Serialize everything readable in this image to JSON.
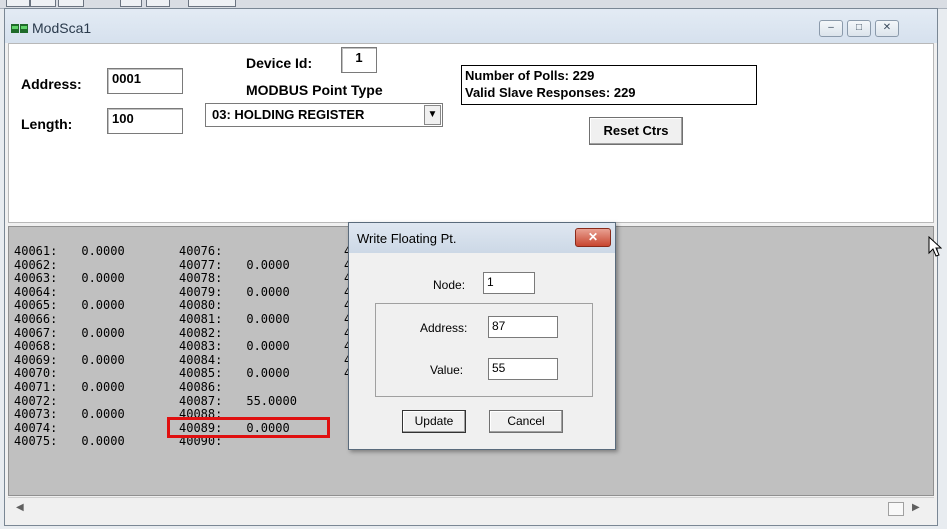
{
  "window": {
    "title": "ModSca1",
    "caption_buttons": [
      "minimize",
      "restore",
      "close"
    ]
  },
  "config": {
    "address_label": "Address:",
    "address_value": "0001",
    "length_label": "Length:",
    "length_value": "100",
    "device_id_label": "Device Id:",
    "device_id_value": "1",
    "point_type_label": "MODBUS Point Type",
    "point_type_value": "03: HOLDING REGISTER",
    "polls_text": "Number of Polls: 229",
    "responses_text": "Valid Slave Responses: 229",
    "reset_label": "Reset Ctrs"
  },
  "registers": {
    "col1": [
      {
        "addr": "40061:",
        "value": "0.0000"
      },
      {
        "addr": "40062:",
        "value": ""
      },
      {
        "addr": "40063:",
        "value": "0.0000"
      },
      {
        "addr": "40064:",
        "value": ""
      },
      {
        "addr": "40065:",
        "value": "0.0000"
      },
      {
        "addr": "40066:",
        "value": ""
      },
      {
        "addr": "40067:",
        "value": "0.0000"
      },
      {
        "addr": "40068:",
        "value": ""
      },
      {
        "addr": "40069:",
        "value": "0.0000"
      },
      {
        "addr": "40070:",
        "value": ""
      },
      {
        "addr": "40071:",
        "value": "0.0000"
      },
      {
        "addr": "40072:",
        "value": ""
      },
      {
        "addr": "40073:",
        "value": "0.0000"
      },
      {
        "addr": "40074:",
        "value": ""
      },
      {
        "addr": "40075:",
        "value": "0.0000"
      }
    ],
    "col2": [
      {
        "addr": "40076:",
        "value": ""
      },
      {
        "addr": "40077:",
        "value": "0.0000"
      },
      {
        "addr": "40078:",
        "value": ""
      },
      {
        "addr": "40079:",
        "value": "0.0000"
      },
      {
        "addr": "40080:",
        "value": ""
      },
      {
        "addr": "40081:",
        "value": "0.0000"
      },
      {
        "addr": "40082:",
        "value": ""
      },
      {
        "addr": "40083:",
        "value": "0.0000"
      },
      {
        "addr": "40084:",
        "value": ""
      },
      {
        "addr": "40085:",
        "value": "0.0000"
      },
      {
        "addr": "40086:",
        "value": ""
      },
      {
        "addr": "40087:",
        "value": "55.0000"
      },
      {
        "addr": "40088:",
        "value": ""
      },
      {
        "addr": "40089:",
        "value": "0.0000"
      },
      {
        "addr": "40090:",
        "value": ""
      }
    ],
    "col3_partial": [
      "4",
      "4",
      "4",
      "4",
      "4",
      "4",
      "4",
      "4",
      "4",
      "4"
    ]
  },
  "dialog": {
    "title": "Write Floating Pt.",
    "node_label": "Node:",
    "node_value": "1",
    "address_label": "Address:",
    "address_value": "87",
    "value_label": "Value:",
    "value_value": "55",
    "update_label": "Update",
    "cancel_label": "Cancel"
  },
  "colors": {
    "highlight": "#e01010",
    "data_background": "#c0c0c0",
    "dialog_close": "#c8462f"
  }
}
